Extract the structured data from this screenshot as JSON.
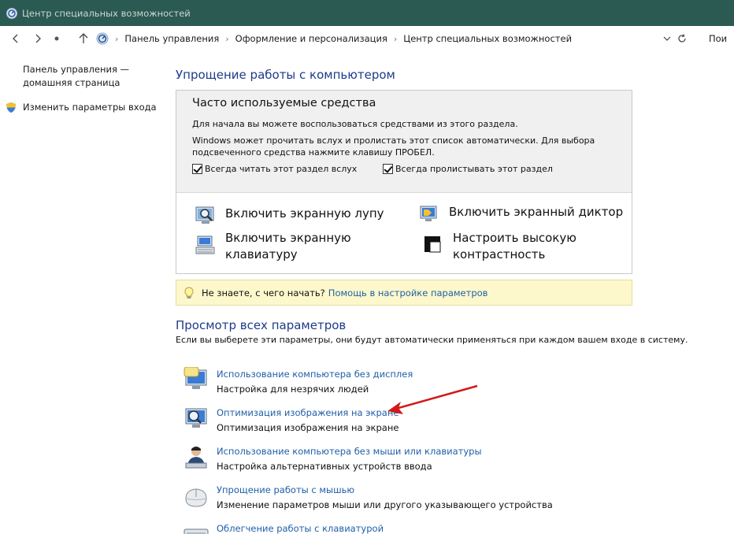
{
  "window": {
    "title": "Центр специальных возможностей"
  },
  "address": {
    "crumbs": [
      "Панель управления",
      "Оформление и персонализация",
      "Центр специальных возможностей"
    ],
    "search_partial": "Пои"
  },
  "sidebar": {
    "home_link": "Панель управления — домашняя страница",
    "signin_link": "Изменить параметры входа"
  },
  "simplify": {
    "heading": "Упрощение работы с компьютером",
    "box_title": "Часто используемые средства",
    "line1": "Для начала вы можете воспользоваться средствами из этого раздела.",
    "line2a": "Windows может прочитать вслух и пролистать этот список автоматически. Для выбора",
    "line2b": "подсвеченного средства нажмите клавишу ПРОБЕЛ.",
    "check_read": "Всегда читать этот раздел вслух",
    "check_scroll": "Всегда пролистывать этот раздел",
    "tool_magnifier": "Включить экранную лупу",
    "tool_narrator": "Включить экранный диктор",
    "tool_keyboard_1": "Включить экранную",
    "tool_keyboard_2": "клавиатуру",
    "tool_contrast_1": "Настроить высокую",
    "tool_contrast_2": "контрастность"
  },
  "tip": {
    "text": "Не знаете, с чего начать?",
    "link": "Помощь в настройке параметров"
  },
  "all_settings": {
    "heading": "Просмотр всех параметров",
    "desc": "Если вы выберете эти параметры, они будут автоматически применяться при каждом вашем входе в систему.",
    "items": [
      {
        "link": "Использование компьютера без дисплея",
        "desc": "Настройка для незрячих людей"
      },
      {
        "link": "Оптимизация изображения на экране",
        "desc": "Оптимизация изображения на экране"
      },
      {
        "link": "Использование компьютера без мыши или клавиатуры",
        "desc": "Настройка альтернативных устройств ввода"
      },
      {
        "link": "Упрощение работы с мышью",
        "desc": "Изменение параметров мыши или другого указывающего устройства"
      },
      {
        "link": "Облегчение работы с клавиатурой",
        "desc": ""
      }
    ]
  },
  "colors": {
    "titlebar": "#2b5a52",
    "link": "#1f5fa8",
    "heading": "#1e3a8a",
    "tip_bg": "#fdf8cc",
    "arrow": "#d11a1a"
  }
}
